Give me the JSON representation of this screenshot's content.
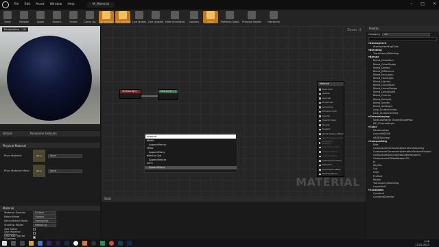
{
  "menubar": {
    "items": [
      "File",
      "Edit",
      "Asset",
      "Window",
      "Help"
    ],
    "tab": "M_Material"
  },
  "toolbar": {
    "items": [
      "Save",
      "Browse",
      "Apply",
      "Search",
      "Home",
      "Clean Up",
      "Connectors",
      "Live Preview",
      "Live Nodes",
      "Live Update",
      "Hide Unrelated",
      "Options",
      "Stats",
      "Platform Stats",
      "Preview Nodes",
      "Hierarchy"
    ]
  },
  "viewport": {
    "perspective": "Perspective",
    "lit": "Lit"
  },
  "graph": {
    "zoom": "Zoom -2",
    "watermark": "MATERIAL",
    "tex_node": "TexCoord[0]",
    "mult_node": "Multiply(1,1)",
    "main_node": "Material",
    "main_pins": [
      "Base Color",
      "Metallic",
      "Specular",
      "Roughness",
      "Anisotropy",
      "Emissive Color",
      "Opacity",
      "Opacity Mask",
      "Normal",
      "Tangent",
      "World Position Offset",
      "World Displacement",
      "Tessellation Multiplier",
      "Subsurface Color",
      "Custom Data 0",
      "Custom Data 1",
      "Ambient Occlusion",
      "Refraction",
      "Pixel Depth Offset",
      "Shading Model"
    ]
  },
  "search_popup": {
    "query": "append",
    "rows": [
      {
        "t": "Math",
        "cat": true
      },
      {
        "t": "AppendVector",
        "cat": false
      },
      {
        "t": "Misc",
        "cat": true
      },
      {
        "t": "AppendMany",
        "cat": false
      },
      {
        "t": "Vector Ops",
        "cat": true
      },
      {
        "t": "AppendVector",
        "cat": false
      },
      {
        "t": "VFX",
        "cat": true
      },
      {
        "t": "AppendMany",
        "cat": false
      }
    ]
  },
  "details": {
    "tabs": [
      "Details",
      "Parameter Defaults"
    ],
    "section1": "Physical Material",
    "rows1": [
      {
        "k": "Phys Material",
        "v": "None"
      },
      {
        "k": "Phys Material Mask",
        "v": "None"
      }
    ],
    "section2": "Material",
    "rows2": [
      {
        "k": "Material Domain",
        "v": "Surface"
      },
      {
        "k": "Blend Mode",
        "v": "Opaque"
      },
      {
        "k": "Decal Blend Mode",
        "v": "Translucent"
      },
      {
        "k": "Shading Model",
        "v": "Default Lit"
      },
      {
        "k": "Two Sided",
        "v": ""
      },
      {
        "k": "Use Material Attributes",
        "v": ""
      },
      {
        "k": "Cast Ray Traced Shadows",
        "v": ""
      }
    ]
  },
  "stats": {
    "title": "Stats"
  },
  "palette": {
    "title": "Palette",
    "category_label": "Category",
    "category_value": "All",
    "search_placeholder": "Search",
    "rows": [
      {
        "t": "Atmosphere",
        "cat": true
      },
      {
        "t": "AtmosphereFogColor"
      },
      {
        "t": "Blending",
        "cat": true
      },
      {
        "t": "TransluencyBlending"
      },
      {
        "t": "Blends",
        "cat": true
      },
      {
        "t": "Blend_ColorBurn"
      },
      {
        "t": "Blend_ColorDodge"
      },
      {
        "t": "Blend_Darken"
      },
      {
        "t": "Blend_Difference"
      },
      {
        "t": "Blend_Exclusion"
      },
      {
        "t": "Blend_HardLight"
      },
      {
        "t": "Blend_Lighten"
      },
      {
        "t": "Blend_LinearBurn"
      },
      {
        "t": "Blend_LinearDodge"
      },
      {
        "t": "Blend_LinearLight"
      },
      {
        "t": "Blend_Overlay"
      },
      {
        "t": "Blend_PinLight"
      },
      {
        "t": "Blend_Screen"
      },
      {
        "t": "Blend_SoftLight"
      },
      {
        "t": "Lerp_ScratchGrime"
      },
      {
        "t": "Lerp_ScratchGrime2"
      },
      {
        "t": "Chromakeying",
        "cat": true
      },
      {
        "t": "SoftColorKeyer:GradeSinglePass"
      },
      {
        "t": "MF_ChromaKeyer"
      },
      {
        "t": "Color",
        "cat": true
      },
      {
        "t": "Desaturation"
      },
      {
        "t": "LinearToSRGB"
      },
      {
        "t": "sRGBToLinear"
      },
      {
        "t": "Compositing",
        "cat": true
      },
      {
        "t": "Bias"
      },
      {
        "t": "ComposureChromaticAberrationSwizzling"
      },
      {
        "t": "ComposureChromaticAberrationTextureSample"
      },
      {
        "t": "ComposureGetChromaticAberrationUV"
      },
      {
        "t": "ComposureUVMapWeaponUV"
      },
      {
        "t": "In"
      },
      {
        "t": "KeyMix"
      },
      {
        "t": "Out"
      },
      {
        "t": "Over"
      },
      {
        "t": "PreMult"
      },
      {
        "t": "Radial"
      },
      {
        "t": "TransluencyBlending"
      },
      {
        "t": "UnpreMult"
      },
      {
        "t": "Constants",
        "cat": true
      },
      {
        "t": "Constant"
      },
      {
        "t": "ConstantDirector"
      }
    ]
  },
  "taskbar": {
    "time": "1:46",
    "date": "13.02.2021"
  },
  "colors": {
    "accent": "#c07a1a",
    "sphere": "#0a0f28",
    "tex_header": "#8a1f1f",
    "mult_header": "#2f6b3a",
    "main_header": "#3a3a3a"
  }
}
